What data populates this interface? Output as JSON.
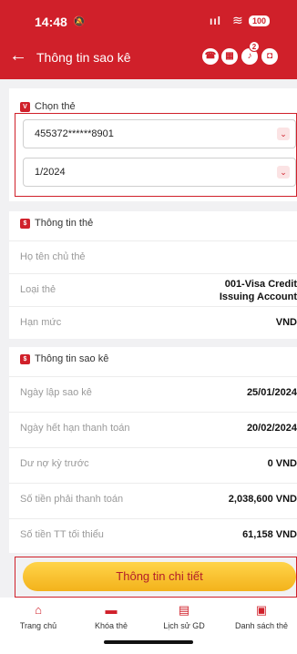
{
  "status_bar": {
    "time": "14:48",
    "battery": "100"
  },
  "header": {
    "title": "Thông tin sao kê",
    "notification_count": "2"
  },
  "card_section": {
    "title": "Chọn thẻ",
    "card_select_value": "455372******8901",
    "period_select_value": "1/2024"
  },
  "card_info": {
    "title": "Thông tin thẻ",
    "rows": [
      {
        "label": "Họ tên chủ thẻ",
        "value": ""
      },
      {
        "label": "Loại thẻ",
        "value_line1": "001-Visa Credit",
        "value_line2": "Issuing Account"
      },
      {
        "label": "Hạn mức",
        "value": "VND"
      }
    ]
  },
  "statement_info": {
    "title": "Thông tin sao kê",
    "rows": [
      {
        "label": "Ngày lập sao kê",
        "value": "25/01/2024"
      },
      {
        "label": "Ngày hết hạn thanh toán",
        "value": "20/02/2024"
      },
      {
        "label": "Dư nợ kỳ trước",
        "value": "0 VND"
      },
      {
        "label": "Số tiền phải thanh toán",
        "value": "2,038,600 VND"
      },
      {
        "label": "Số tiền TT tối thiểu",
        "value": "61,158 VND"
      }
    ]
  },
  "detail_button": "Thông tin chi tiết",
  "tabs": [
    {
      "label": "Trang chủ",
      "icon": "home-icon"
    },
    {
      "label": "Khóa thẻ",
      "icon": "card-lock-icon"
    },
    {
      "label": "Lịch sử GD",
      "icon": "history-icon"
    },
    {
      "label": "Danh sách thẻ",
      "icon": "card-list-icon"
    }
  ],
  "colors": {
    "primary": "#d0202a",
    "button": "#f3b21b"
  }
}
